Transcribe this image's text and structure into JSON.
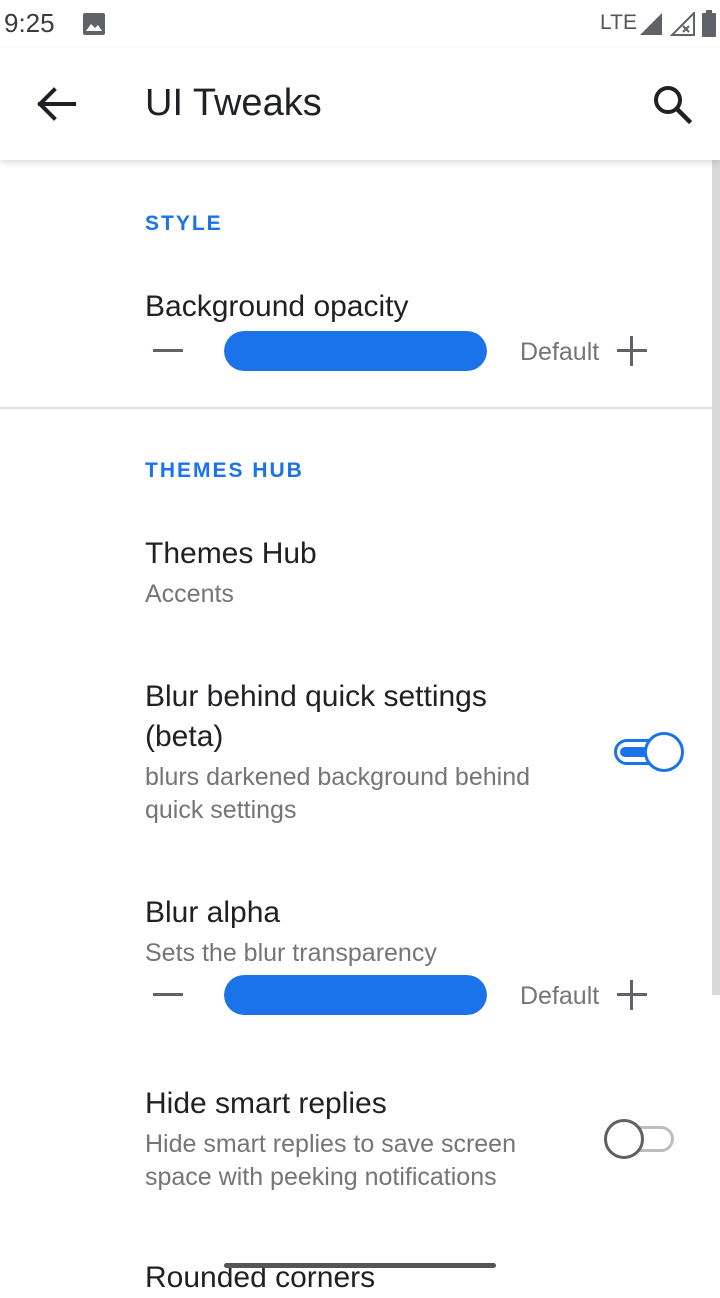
{
  "status_bar": {
    "time": "9:25",
    "network": "LTE",
    "icons": [
      "image-icon",
      "signal-icon",
      "signal-no-service-icon",
      "battery-icon"
    ]
  },
  "app_bar": {
    "title": "UI Tweaks",
    "back_icon": "arrow-back-icon",
    "search_icon": "search-icon"
  },
  "sections": {
    "style": {
      "header": "STYLE",
      "background_opacity": {
        "title": "Background opacity",
        "value": 1.0,
        "default_label": "Default"
      }
    },
    "themes_hub": {
      "header": "THEMES HUB",
      "themes_hub_item": {
        "title": "Themes Hub",
        "summary": "Accents"
      },
      "blur_qs": {
        "title_line1": "Blur behind quick settings",
        "title_line2": "(beta)",
        "summary_line1": "blurs darkened background behind",
        "summary_line2": "quick settings",
        "enabled": true
      },
      "blur_alpha": {
        "title": "Blur alpha",
        "summary": "Sets the blur transparency",
        "value": 1.0,
        "default_label": "Default"
      },
      "hide_smart_replies": {
        "title": "Hide smart replies",
        "summary_line1": "Hide smart replies to save screen",
        "summary_line2": "space with peeking notifications",
        "enabled": false
      },
      "rounded_corners": {
        "title": "Rounded corners"
      }
    }
  },
  "colors": {
    "accent": "#1a73e8",
    "text_primary": "#202124",
    "text_secondary": "#757575"
  }
}
